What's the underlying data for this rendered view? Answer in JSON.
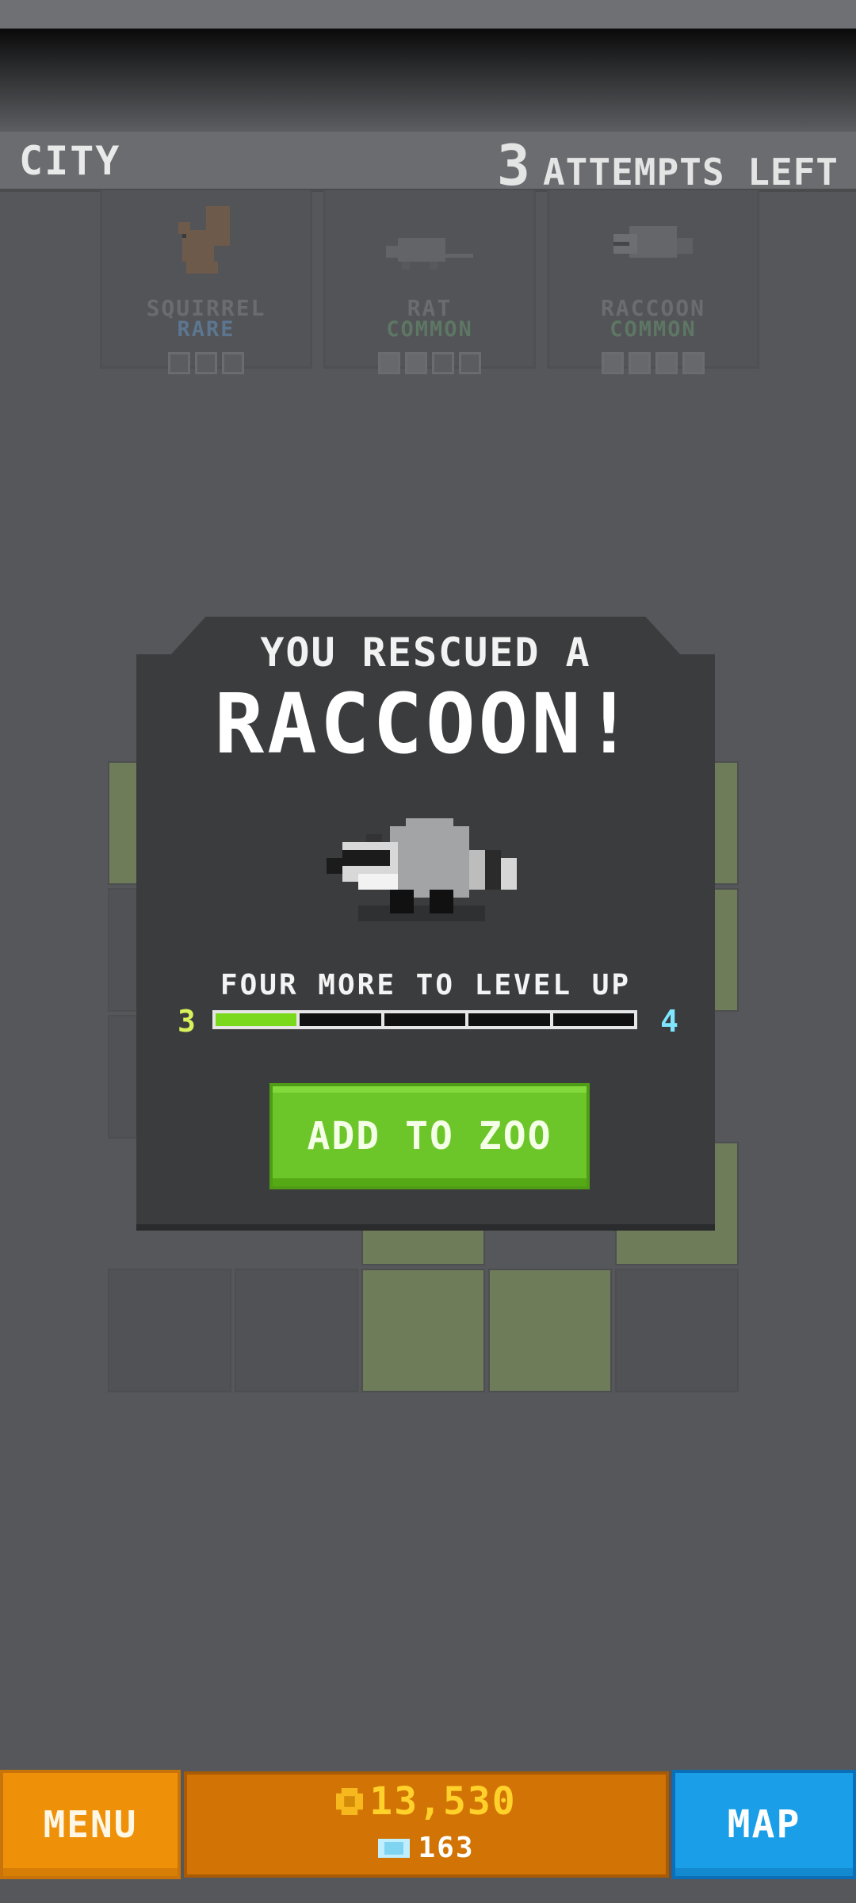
{
  "header": {
    "location": "CITY",
    "attempts_count": "3",
    "attempts_label": "ATTEMPTS LEFT"
  },
  "cards": [
    {
      "name": "SQUIRREL",
      "rarity": "RARE",
      "rarity_color": "#5d7690",
      "icon": "squirrel-icon"
    },
    {
      "name": "RAT",
      "rarity": "COMMON",
      "rarity_color": "#5e7664",
      "icon": "rat-icon"
    },
    {
      "name": "RACCOON",
      "rarity": "COMMON",
      "rarity_color": "#5e7664",
      "icon": "raccoon-icon"
    }
  ],
  "modal": {
    "rescued_label": "YOU RESCUED A",
    "animal_name": "RACCOON!",
    "levelup_label": "FOUR MORE TO LEVEL UP",
    "level_from": "3",
    "level_to": "4",
    "progress_filled": 1,
    "progress_total": 5,
    "button_label": "ADD TO ZOO"
  },
  "bottom": {
    "menu_label": "MENU",
    "coins": "13,530",
    "gems": "163",
    "map_label": "MAP"
  },
  "colors": {
    "accent_green": "#6cc62a",
    "menu_orange": "#ee9109",
    "map_blue": "#1a9ee8",
    "coin_yellow": "#ffd12a"
  }
}
